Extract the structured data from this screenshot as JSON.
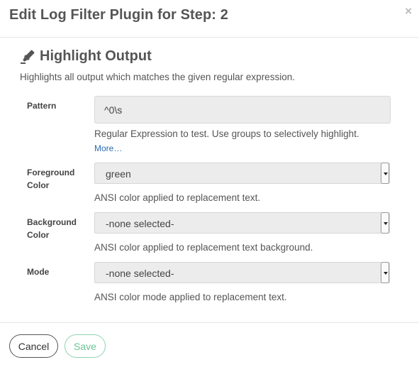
{
  "header": {
    "title": "Edit Log Filter Plugin for Step: 2",
    "close_glyph": "×"
  },
  "plugin": {
    "icon": "highlighter-icon",
    "title": "Highlight Output",
    "description": "Highlights all output which matches the given regular expression."
  },
  "fields": {
    "pattern": {
      "label": "Pattern",
      "value": "^0\\s",
      "help": "Regular Expression to test. Use groups to selectively highlight.",
      "more_link": "More…"
    },
    "foreground": {
      "label": "Foreground Color",
      "value": "green",
      "help": "ANSI color applied to replacement text."
    },
    "background": {
      "label": "Background Color",
      "value": "-none selected-",
      "help": "ANSI color applied to replacement text background."
    },
    "mode": {
      "label": "Mode",
      "value": "-none selected-",
      "help": "ANSI color mode applied to replacement text."
    }
  },
  "footer": {
    "cancel_label": "Cancel",
    "save_label": "Save"
  },
  "colors": {
    "link": "#2a6cb0",
    "save_accent": "#6cc494"
  }
}
